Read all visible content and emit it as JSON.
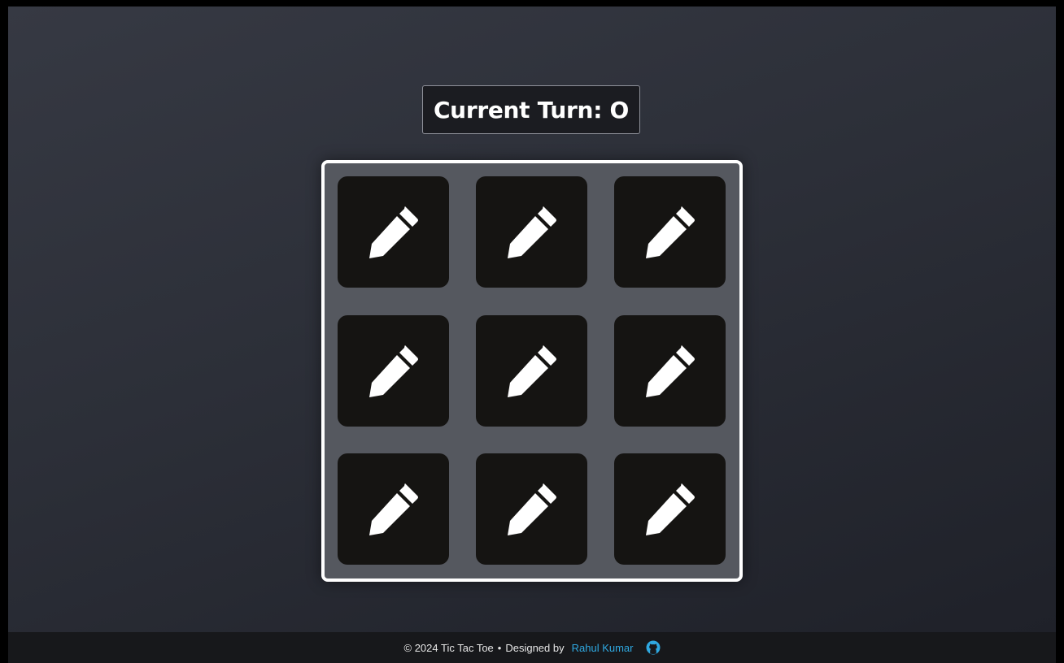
{
  "status": {
    "current_turn_label": "Current Turn: O"
  },
  "board": {
    "cells": [
      {
        "id": "r1c1",
        "mark": "",
        "icon": "pencil-icon"
      },
      {
        "id": "r1c2",
        "mark": "",
        "icon": "pencil-icon"
      },
      {
        "id": "r1c3",
        "mark": "",
        "icon": "pencil-icon"
      },
      {
        "id": "r2c1",
        "mark": "",
        "icon": "pencil-icon"
      },
      {
        "id": "r2c2",
        "mark": "",
        "icon": "pencil-icon"
      },
      {
        "id": "r2c3",
        "mark": "",
        "icon": "pencil-icon"
      },
      {
        "id": "r3c1",
        "mark": "",
        "icon": "pencil-icon"
      },
      {
        "id": "r3c2",
        "mark": "",
        "icon": "pencil-icon"
      },
      {
        "id": "r3c3",
        "mark": "",
        "icon": "pencil-icon"
      }
    ]
  },
  "footer": {
    "copyright": "© 2024 Tic Tac Toe",
    "separator": "•",
    "designed_by": "Designed by",
    "author": "Rahul Kumar",
    "github_icon": "github-icon"
  },
  "colors": {
    "background_top": "#363943",
    "background_bottom": "#1f2129",
    "board": "#55585f",
    "board_border": "#ffffff",
    "cell": "#151412",
    "link": "#2fa8e0"
  }
}
